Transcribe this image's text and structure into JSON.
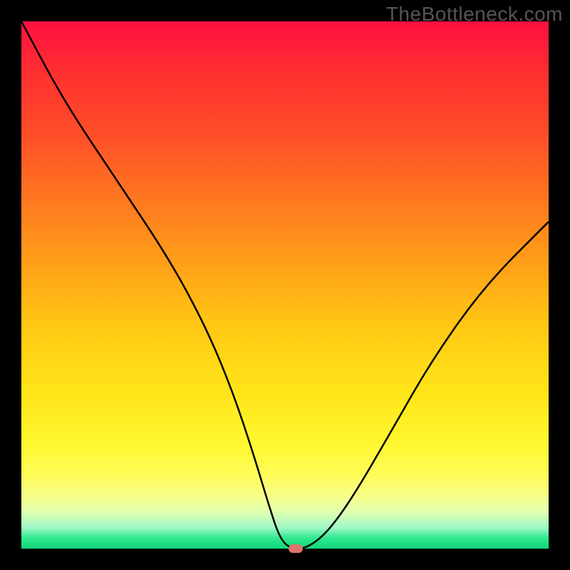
{
  "watermark": "TheBottleneck.com",
  "chart_data": {
    "type": "line",
    "title": "",
    "xlabel": "",
    "ylabel": "",
    "xlim": [
      0,
      100
    ],
    "ylim": [
      0,
      100
    ],
    "background_gradient": {
      "top": "#ff1040",
      "mid": "#ffd020",
      "bottom": "#10d878"
    },
    "series": [
      {
        "name": "bottleneck-curve",
        "x": [
          0,
          8,
          18,
          28,
          35,
          40,
          44,
          47,
          49,
          51,
          54,
          58,
          63,
          70,
          78,
          88,
          100
        ],
        "y": [
          100,
          85,
          70,
          55,
          42,
          30,
          18,
          8,
          2,
          0,
          0,
          3,
          10,
          22,
          36,
          50,
          62
        ]
      }
    ],
    "marker": {
      "x": 52,
      "y": 0,
      "color": "#e0736b"
    }
  }
}
